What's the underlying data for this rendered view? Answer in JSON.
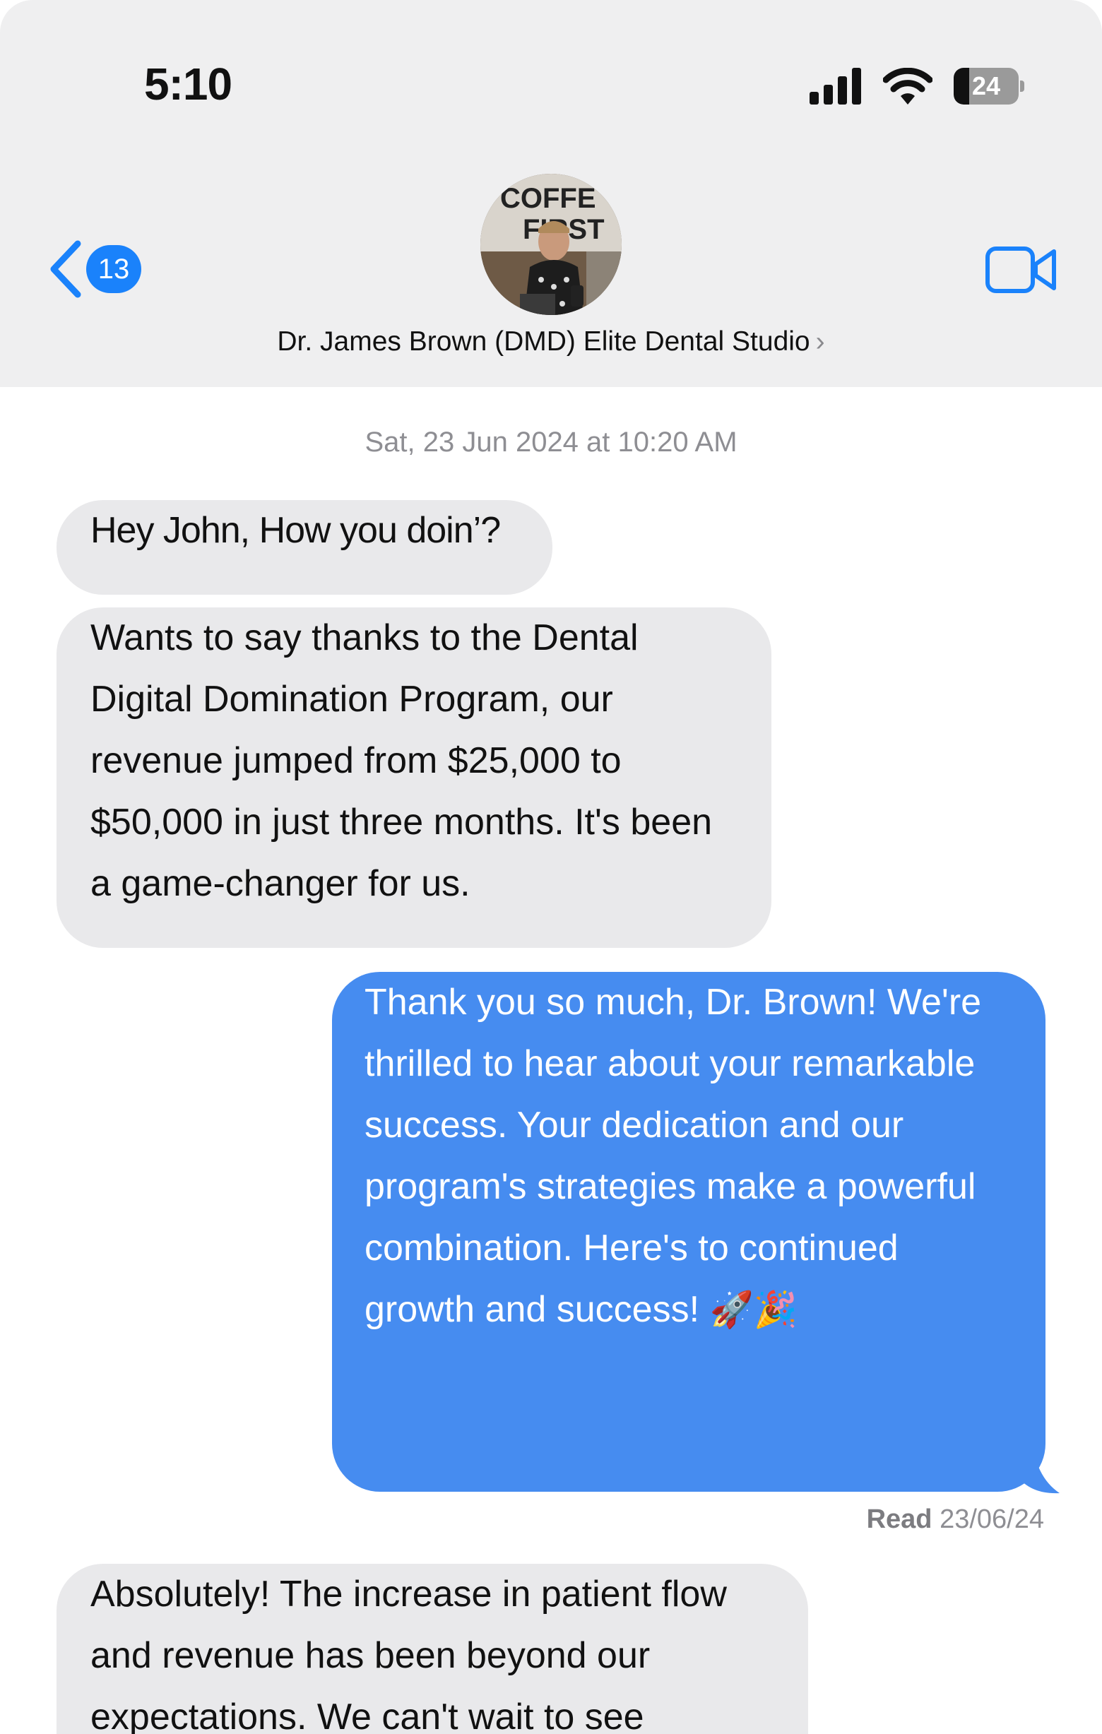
{
  "status_bar": {
    "time": "5:10",
    "battery_level": "24",
    "battery_fraction": 0.24
  },
  "header": {
    "back_count": "13",
    "contact_name": "Dr. James Brown (DMD) Elite Dental Studio",
    "contact_chevron": "›",
    "avatar_icon": "contact-photo",
    "video_icon": "video-camera-icon"
  },
  "colors": {
    "header_bg": "#efeff0",
    "accent_blue": "#1a82fb",
    "outgoing_bubble": "#468cf0",
    "incoming_bubble": "#e9e9eb"
  },
  "conversation": {
    "timestamp": "Sat, 23 Jun 2024 at 10:20 AM",
    "messages": [
      {
        "direction": "in",
        "text": "Hey John, How you doin’?"
      },
      {
        "direction": "in",
        "text": "Wants to say thanks to the Dental Digital Domination Program, our revenue jumped from $25,000 to $50,000 in just three months. It's been a game-changer for us."
      },
      {
        "direction": "out",
        "text": "Thank you so much, Dr. Brown! We're thrilled to hear about your remarkable success. Your dedication and our program's strategies make a powerful combination. Here's to continued growth and success!",
        "emoji": "🚀🎉"
      },
      {
        "direction": "in",
        "text": "Absolutely! The increase in patient flow and revenue has been beyond our expectations. We can't wait to see"
      }
    ],
    "read_label": "Read",
    "read_date": "23/06/24"
  }
}
